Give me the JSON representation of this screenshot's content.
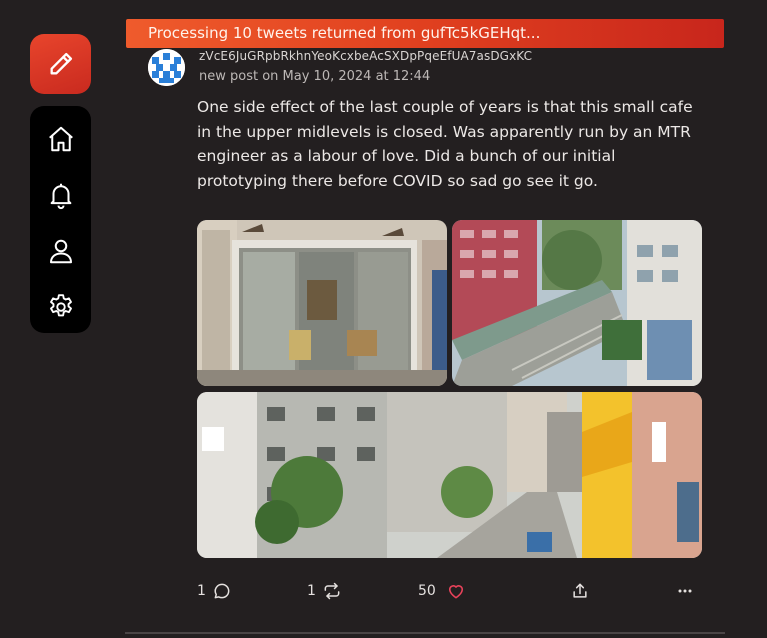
{
  "banner": {
    "text": "Processing 10 tweets returned from gufTc5kGEHqt..."
  },
  "nav": {
    "compose_icon": "pencil-icon",
    "items": [
      {
        "icon": "home-icon"
      },
      {
        "icon": "bell-icon"
      },
      {
        "icon": "user-icon"
      },
      {
        "icon": "gear-icon"
      }
    ]
  },
  "post": {
    "author": "zVcE6JuGRpbRkhnYeoKcxbeAcSXDpPqeEfUA7asDGxKC",
    "meta": "new post on May 10, 2024 at 12:44",
    "text": "One side effect of the last couple of years is that this small cafe in the upper midlevels is closed. Was apparently run by an MTR engineer as a labour of love. Did a bunch of our initial prototyping there before COVID so sad go see it go.",
    "images": [
      "closed cafe storefront",
      "hillside escalator walkway",
      "narrow street with shops"
    ],
    "actions": {
      "replies": "1",
      "reposts": "1",
      "likes": "50"
    }
  },
  "colors": {
    "accent": "#e0401f",
    "background": "#231f20",
    "like": "#e8425a"
  }
}
